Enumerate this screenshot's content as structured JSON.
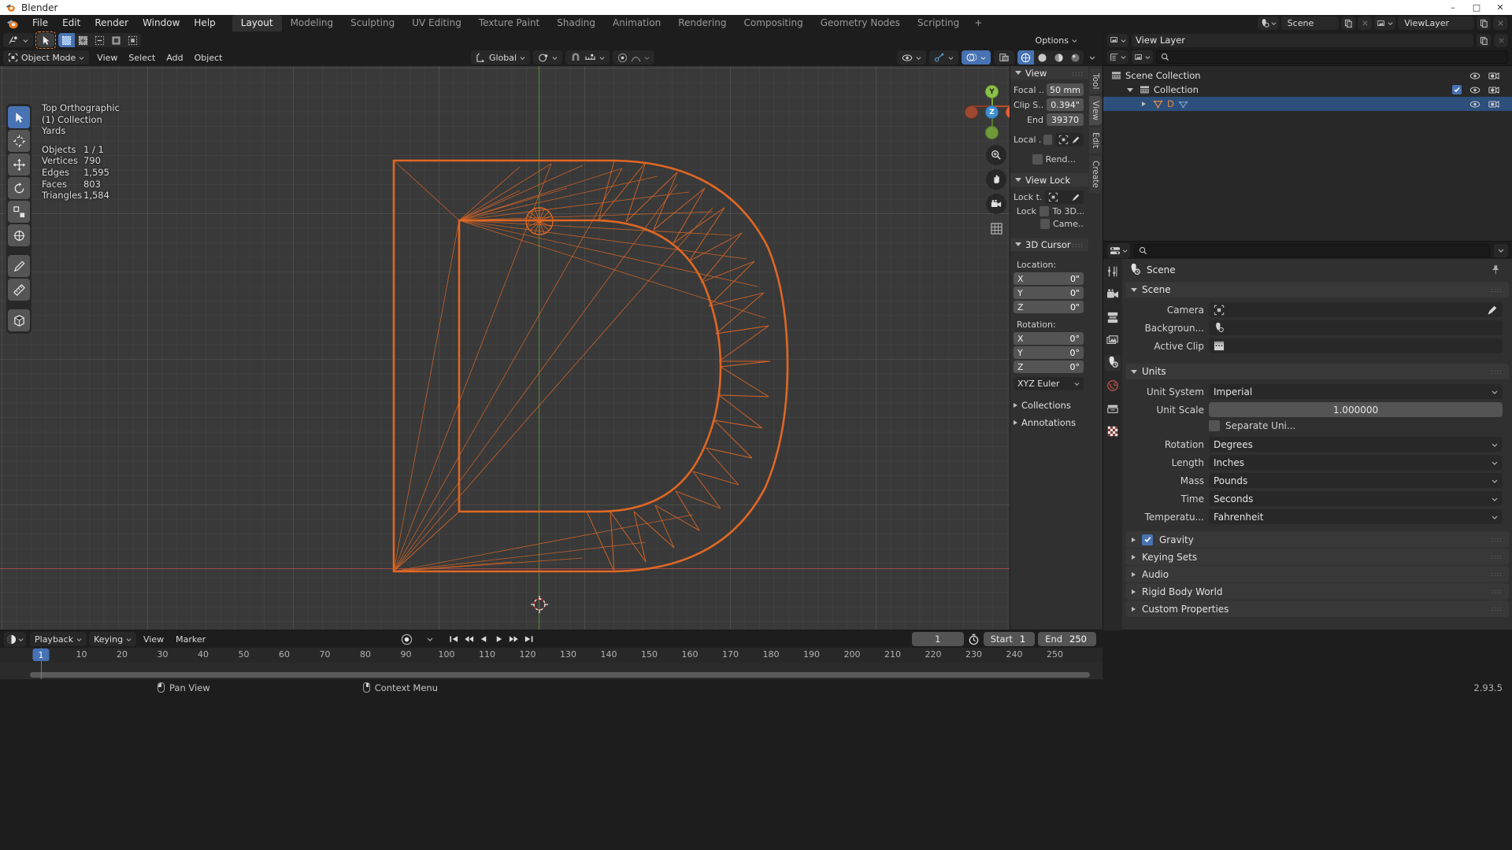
{
  "window": {
    "title": "Blender",
    "minimize": "–",
    "maximize": "□",
    "close": "✕"
  },
  "topbar": {
    "menus": [
      "File",
      "Edit",
      "Render",
      "Window",
      "Help"
    ],
    "workspaces": [
      {
        "label": "Layout",
        "active": true
      },
      {
        "label": "Modeling",
        "active": false
      },
      {
        "label": "Sculpting",
        "active": false
      },
      {
        "label": "UV Editing",
        "active": false
      },
      {
        "label": "Texture Paint",
        "active": false
      },
      {
        "label": "Shading",
        "active": false
      },
      {
        "label": "Animation",
        "active": false
      },
      {
        "label": "Rendering",
        "active": false
      },
      {
        "label": "Compositing",
        "active": false
      },
      {
        "label": "Geometry Nodes",
        "active": false
      },
      {
        "label": "Scripting",
        "active": false
      }
    ],
    "add_workspace": "+",
    "scene_name": "Scene",
    "view_layer_name": "ViewLayer"
  },
  "viewport": {
    "header": {
      "mode": "Object Mode",
      "menus": [
        "View",
        "Select",
        "Add",
        "Object"
      ],
      "transform_orientation": "Global",
      "options": "Options"
    },
    "overlay_stats": {
      "view_name": "Top Orthographic",
      "collection": "(1) Collection",
      "unit": "Yards",
      "rows": [
        {
          "key": "Objects",
          "value": "1 / 1"
        },
        {
          "key": "Vertices",
          "value": "790"
        },
        {
          "key": "Edges",
          "value": "1,595"
        },
        {
          "key": "Faces",
          "value": "803"
        },
        {
          "key": "Triangles",
          "value": "1,584"
        }
      ]
    },
    "gizmo_axes": {
      "x": "X",
      "y": "Y",
      "z": "Z"
    }
  },
  "npanel": {
    "tabs": [
      "Tool",
      "View",
      "Edit",
      "Create"
    ],
    "active_tab": "View",
    "view": {
      "title": "View",
      "rows": [
        {
          "label": "Focal ...",
          "value": "50 mm"
        },
        {
          "label": "Clip S...",
          "value": "0.394\""
        },
        {
          "label": "End",
          "value": "39370"
        }
      ],
      "local_label": "Local ...",
      "render_label": "Rend..."
    },
    "view_lock": {
      "title": "View Lock",
      "lock_to_label": "Lock t...",
      "lock_label": "Lock",
      "to_3d_label": "To 3D...",
      "camera_label": "Came..."
    },
    "cursor": {
      "title": "3D Cursor",
      "location_label": "Location:",
      "location": [
        {
          "axis": "X",
          "value": "0\""
        },
        {
          "axis": "Y",
          "value": "0\""
        },
        {
          "axis": "Z",
          "value": "0\""
        }
      ],
      "rotation_label": "Rotation:",
      "rotation": [
        {
          "axis": "X",
          "value": "0°"
        },
        {
          "axis": "Y",
          "value": "0°"
        },
        {
          "axis": "Z",
          "value": "0°"
        }
      ],
      "rotation_mode": "XYZ Euler"
    },
    "collections_label": "Collections",
    "annotations_label": "Annotations"
  },
  "outliner": {
    "display_mode": "View Layer",
    "search_placeholder": "",
    "rows": [
      {
        "label": "Scene Collection",
        "indent": 0,
        "selected": false,
        "icon": "collection-icon"
      },
      {
        "label": "Collection",
        "indent": 1,
        "selected": false,
        "icon": "collection-icon"
      },
      {
        "label": "D",
        "indent": 2,
        "selected": true,
        "icon": "mesh-icon"
      }
    ]
  },
  "properties": {
    "breadcrumb": "Scene",
    "tabs": [
      "tool-icon",
      "render-icon",
      "output-icon",
      "view-layer-icon",
      "scene-icon",
      "world-icon",
      "collection-icon",
      "texture-icon"
    ],
    "active_tab_index": 4,
    "scene_panel": {
      "title": "Scene",
      "rows": [
        {
          "label": "Camera",
          "value": ""
        },
        {
          "label": "Backgroun...",
          "value": ""
        },
        {
          "label": "Active Clip",
          "value": ""
        }
      ]
    },
    "units_panel": {
      "title": "Units",
      "unit_system_label": "Unit System",
      "unit_system_value": "Imperial",
      "unit_scale_label": "Unit Scale",
      "unit_scale_value": "1.000000",
      "separate_units_label": "Separate Uni...",
      "rotation_label": "Rotation",
      "rotation_value": "Degrees",
      "length_label": "Length",
      "length_value": "Inches",
      "mass_label": "Mass",
      "mass_value": "Pounds",
      "time_label": "Time",
      "time_value": "Seconds",
      "temperature_label": "Temperatu...",
      "temperature_value": "Fahrenheit"
    },
    "collapsed_panels": [
      {
        "label": "Gravity",
        "checked": true
      },
      {
        "label": "Keying Sets",
        "checked": false
      },
      {
        "label": "Audio",
        "checked": false
      },
      {
        "label": "Rigid Body World",
        "checked": false
      },
      {
        "label": "Custom Properties",
        "checked": false
      }
    ]
  },
  "timeline": {
    "menus": [
      "Playback",
      "Keying",
      "View",
      "Marker"
    ],
    "current_frame": "1",
    "start_label": "Start",
    "start_value": "1",
    "end_label": "End",
    "end_value": "250",
    "ticks": [
      "1",
      "10",
      "20",
      "30",
      "40",
      "50",
      "60",
      "70",
      "80",
      "90",
      "100",
      "110",
      "120",
      "130",
      "140",
      "150",
      "160",
      "170",
      "180",
      "190",
      "200",
      "210",
      "220",
      "230",
      "240",
      "250"
    ]
  },
  "statusbar": {
    "items": [
      {
        "icon": "mouse-left-icon",
        "label": "Pan View"
      },
      {
        "icon": "mouse-middle-icon",
        "label": "Context Menu"
      }
    ],
    "version": "2.93.5"
  },
  "colors": {
    "accent_blue": "#4772b3",
    "selection_orange": "#ed722f",
    "mesh_orange": "#e06724",
    "bg_dark": "#1d1d1d",
    "bg_panel": "#303030",
    "viewport_bg": "#393939",
    "axis_y_green": "#5a8a3c",
    "axis_x_red": "#9e4a4a"
  }
}
